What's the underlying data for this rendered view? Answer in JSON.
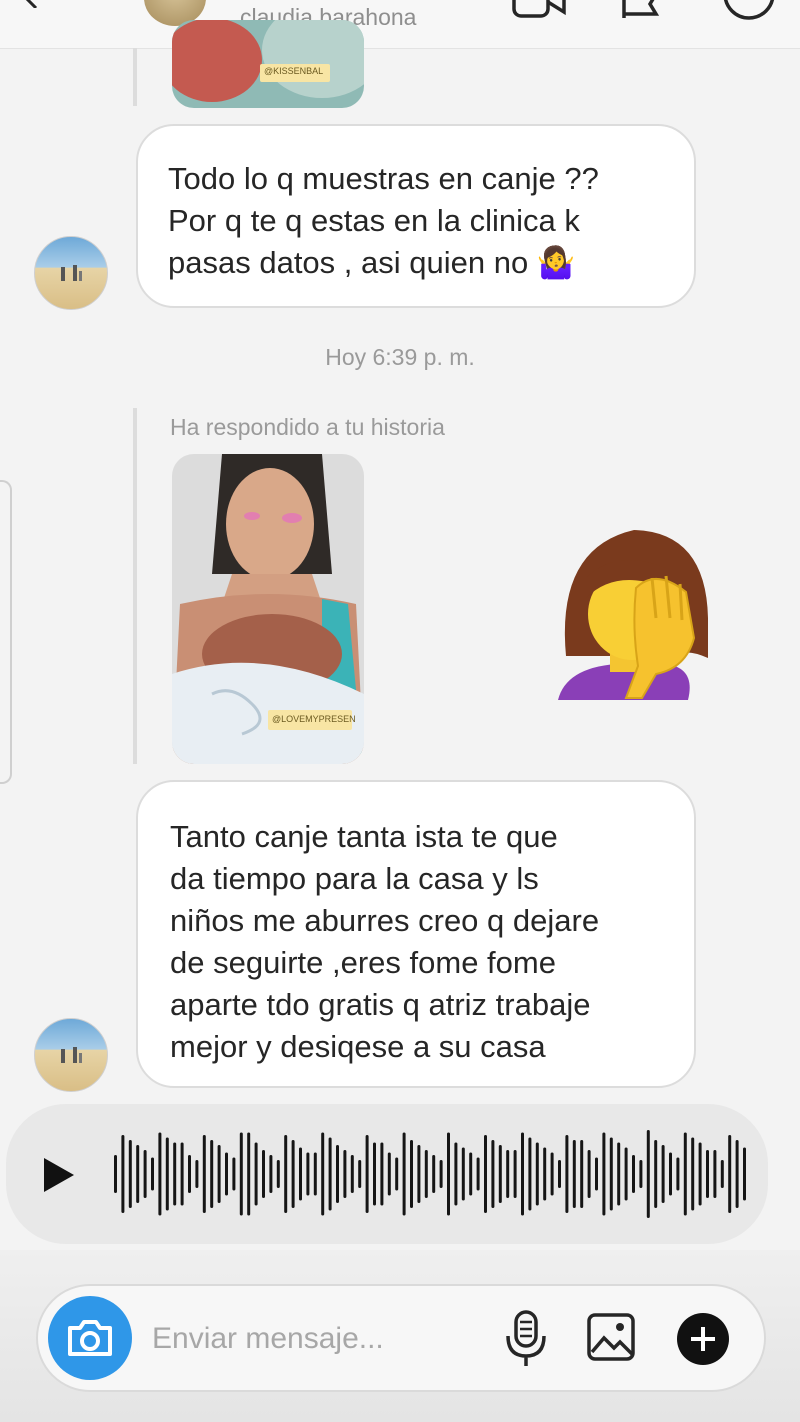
{
  "header": {
    "contact_name": "claudia barahona",
    "icons": [
      "back-arrow-icon",
      "video-camera-icon",
      "flag-icon",
      "info-icon"
    ]
  },
  "thread": {
    "story_sticker_1": "@KISSENBAL",
    "message_1": "Todo lo q muestras en canje ??\nPor q te q estas en la clinica k\npasas datos , asi quien no 🤷‍♀️",
    "timestamp": "Hoy 6:39 p. m.",
    "replied_label": "Ha respondido a tu historia",
    "story_sticker_2": "@LOVEMYPRESEN",
    "reaction_emoji": "🤦‍♀️",
    "message_2": "Tanto canje  tanta ista te que\nda tiempo para la casa y ls\nniños me aburres creo q dejare\nde seguirte ,eres fome fome\naparte tdo gratis q atriz trabaje\nmejor  y desiqese a su casa"
  },
  "audio": {
    "icon": "play-icon"
  },
  "composer": {
    "placeholder": "Enviar mensaje...",
    "icons": [
      "camera-icon",
      "microphone-icon",
      "gallery-icon",
      "add-icon"
    ],
    "accent_color": "#2f97e8"
  }
}
